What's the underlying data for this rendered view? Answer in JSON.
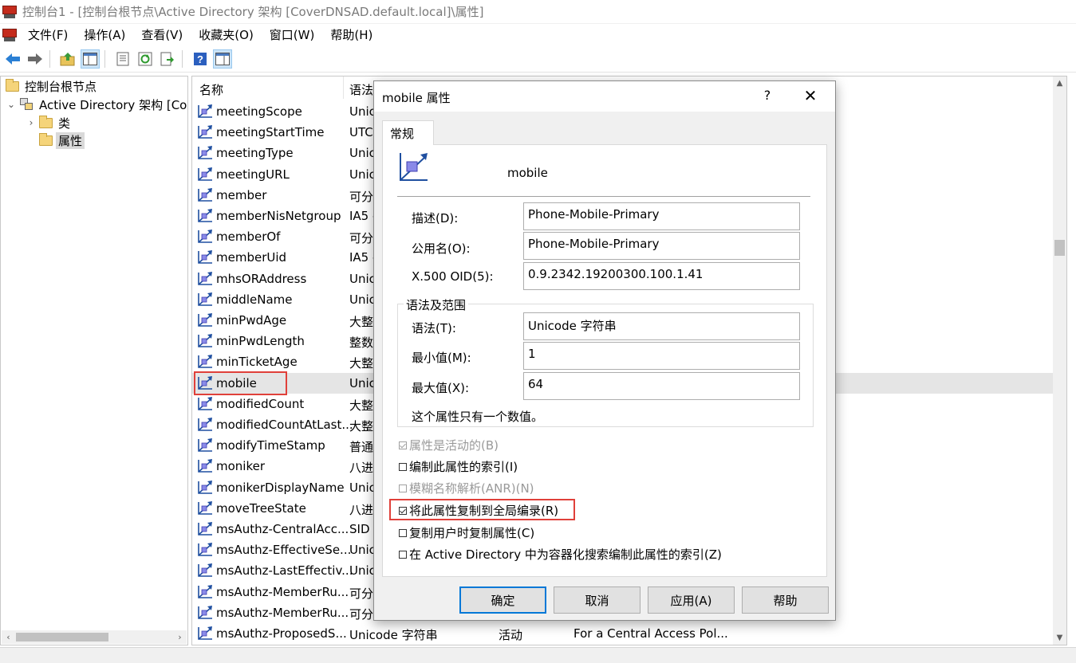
{
  "window": {
    "title": "控制台1 - [控制台根节点\\Active Directory 架构 [CoverDNSAD.default.local]\\属性]"
  },
  "menu": [
    "文件(F)",
    "操作(A)",
    "查看(V)",
    "收藏夹(O)",
    "窗口(W)",
    "帮助(H)"
  ],
  "toolbar": {
    "icons": [
      "back-icon",
      "forward-icon",
      "up-folder-icon",
      "show-tree-icon",
      "properties-icon",
      "refresh-icon",
      "export-icon",
      "help-icon",
      "show-action-pane-icon"
    ]
  },
  "tree": {
    "root": "控制台根节点",
    "schema": "Active Directory 架构 [Cov",
    "classes": "类",
    "attributes": "属性"
  },
  "list": {
    "columns": [
      "名称",
      "语法"
    ],
    "rows": [
      {
        "name": "meetingScope",
        "syntax": "Unic"
      },
      {
        "name": "meetingStartTime",
        "syntax": "UTC"
      },
      {
        "name": "meetingType",
        "syntax": "Unic"
      },
      {
        "name": "meetingURL",
        "syntax": "Unic"
      },
      {
        "name": "member",
        "syntax": "可分"
      },
      {
        "name": "memberNisNetgroup",
        "syntax": "IA5 -"
      },
      {
        "name": "memberOf",
        "syntax": "可分"
      },
      {
        "name": "memberUid",
        "syntax": "IA5 -"
      },
      {
        "name": "mhsORAddress",
        "syntax": "Unic"
      },
      {
        "name": "middleName",
        "syntax": "Unic"
      },
      {
        "name": "minPwdAge",
        "syntax": "大整"
      },
      {
        "name": "minPwdLength",
        "syntax": "整数"
      },
      {
        "name": "minTicketAge",
        "syntax": "大整"
      },
      {
        "name": "mobile",
        "syntax": "Unic"
      },
      {
        "name": "modifiedCount",
        "syntax": "大整"
      },
      {
        "name": "modifiedCountAtLast...",
        "syntax": "大整"
      },
      {
        "name": "modifyTimeStamp",
        "syntax": "普通"
      },
      {
        "name": "moniker",
        "syntax": "八进"
      },
      {
        "name": "monikerDisplayName",
        "syntax": "Unic"
      },
      {
        "name": "moveTreeState",
        "syntax": "八进"
      },
      {
        "name": "msAuthz-CentralAcc...",
        "syntax": "SID"
      },
      {
        "name": "msAuthz-EffectiveSe...",
        "syntax": "Unic"
      },
      {
        "name": "msAuthz-LastEffectiv...",
        "syntax": "Unic"
      },
      {
        "name": "msAuthz-MemberRu...",
        "syntax": "可分"
      },
      {
        "name": "msAuthz-MemberRu...",
        "syntax": "可分"
      },
      {
        "name": "msAuthz-ProposedS...",
        "syntax": "Unicode 字符串",
        "state": "活动",
        "desc": "For a Central Access Pol..."
      }
    ]
  },
  "dialog": {
    "title": "mobile 属性",
    "help": "?",
    "close": "✕",
    "tab": "常规",
    "attr_name": "mobile",
    "labels": {
      "desc": "描述(D):",
      "common": "公用名(O):",
      "oid": "X.500 OID(5):",
      "group": "语法及范围",
      "syntax": "语法(T):",
      "min": "最小值(M):",
      "max": "最大值(X):"
    },
    "values": {
      "desc": "Phone-Mobile-Primary",
      "common": "Phone-Mobile-Primary",
      "oid": "0.9.2342.19200300.100.1.41",
      "syntax": "Unicode 字符串",
      "min": "1",
      "max": "64"
    },
    "single_value_note": "这个属性只有一个数值。",
    "checkboxes": [
      {
        "label": "属性是活动的(B)",
        "checked": true,
        "disabled": true
      },
      {
        "label": "编制此属性的索引(I)",
        "checked": false,
        "disabled": false
      },
      {
        "label": "模糊名称解析(ANR)(N)",
        "checked": false,
        "disabled": true
      },
      {
        "label": "将此属性复制到全局编录(R)",
        "checked": true,
        "disabled": false
      },
      {
        "label": "复制用户时复制属性(C)",
        "checked": false,
        "disabled": false
      },
      {
        "label": "在 Active Directory 中为容器化搜索编制此属性的索引(Z)",
        "checked": false,
        "disabled": false
      }
    ],
    "buttons": {
      "ok": "确定",
      "cancel": "取消",
      "apply": "应用(A)",
      "help": "帮助"
    }
  },
  "colors": {
    "highlight": "#e0403a",
    "accent": "#0078d7"
  }
}
